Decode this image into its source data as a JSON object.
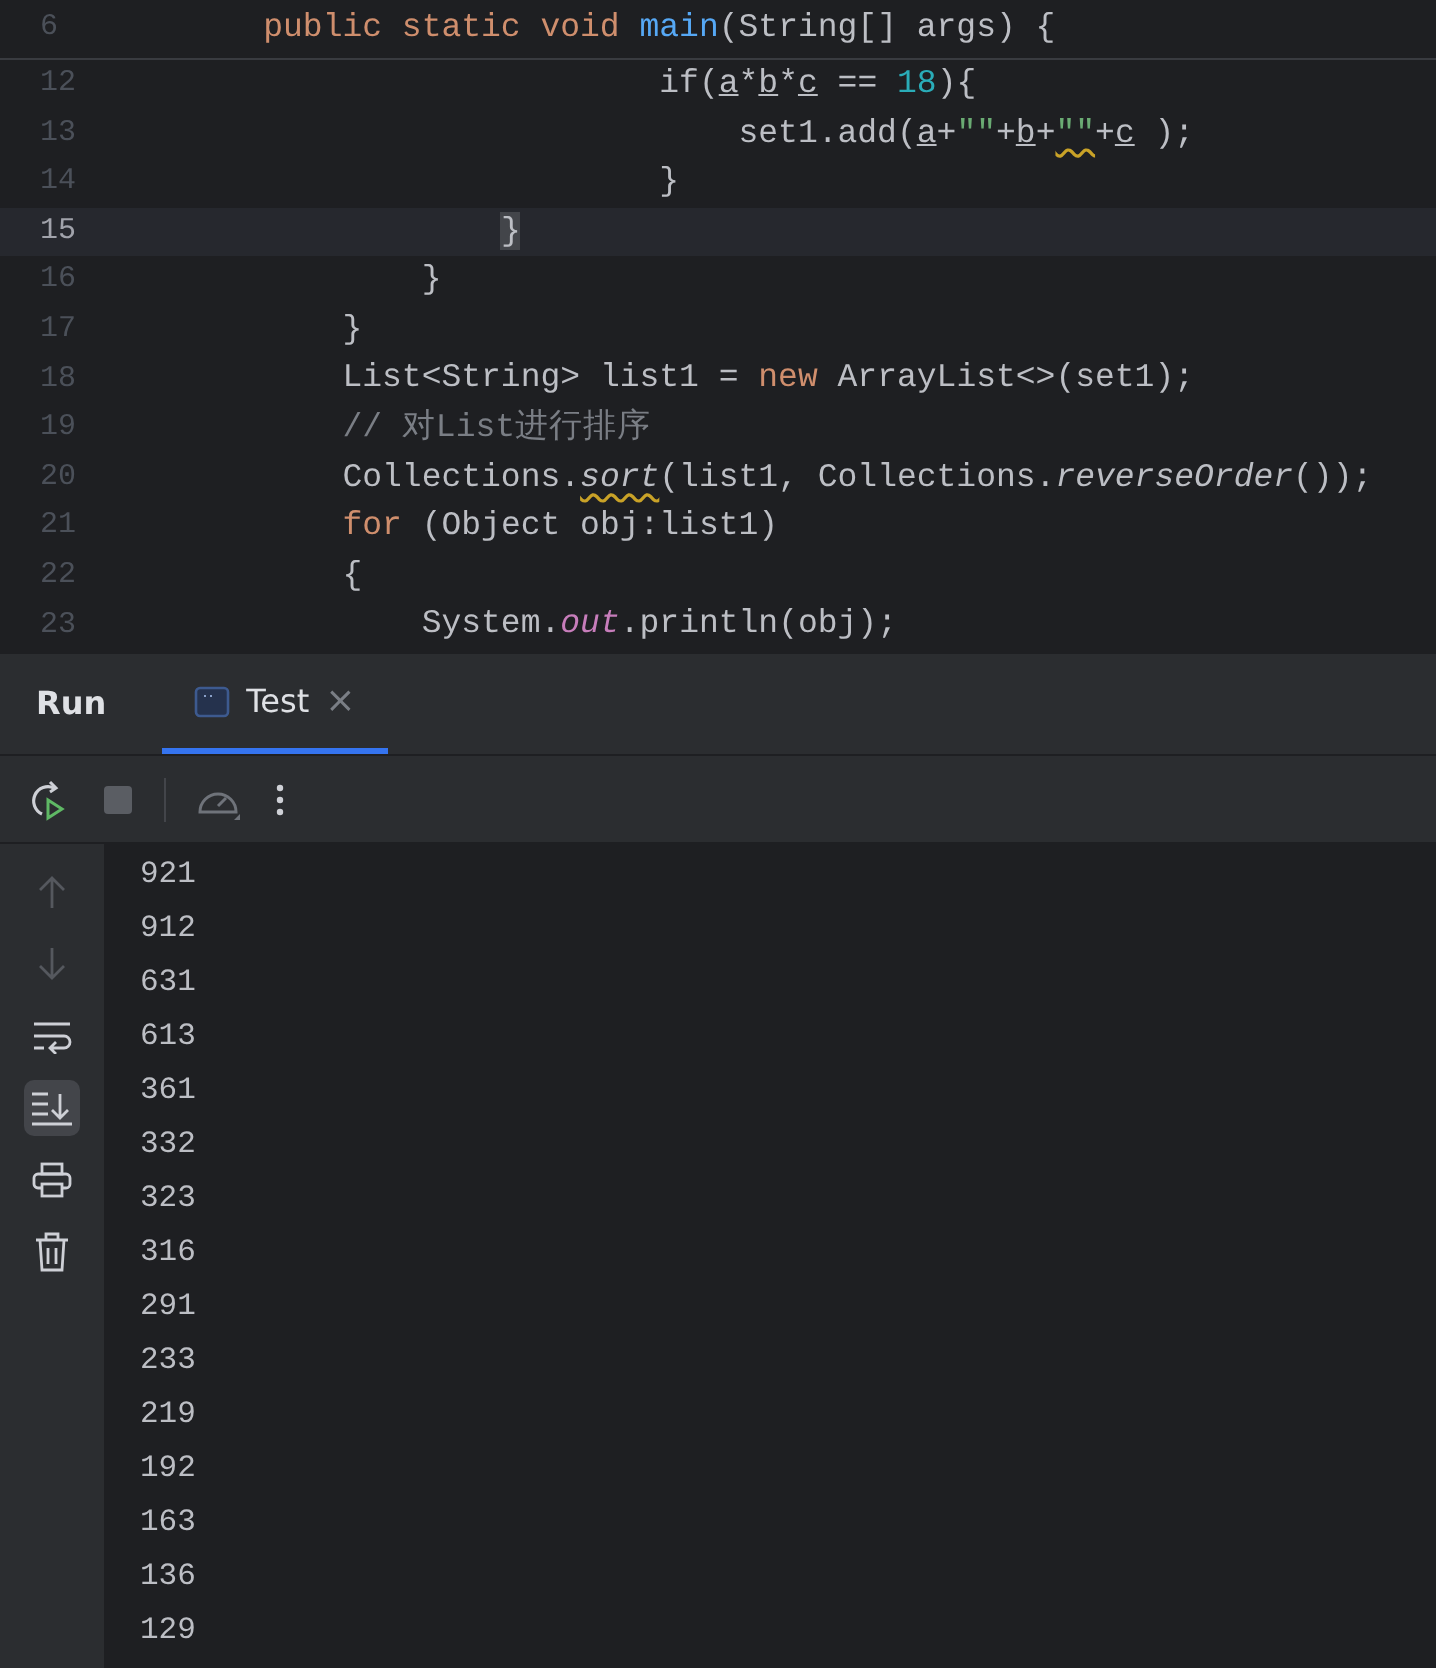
{
  "editor": {
    "sticky_line": {
      "number": "6",
      "tokens": [
        {
          "t": "    public static void ",
          "kind": "kw"
        },
        {
          "t": "main",
          "kind": "fn"
        },
        {
          "t": "(String[] args) {",
          "kind": "plain"
        }
      ]
    },
    "lines": [
      {
        "number": "12",
        "current": false,
        "tokens": [
          {
            "t": "                        if(",
            "kind": "plain"
          },
          {
            "t": "a",
            "kind": "var"
          },
          {
            "t": "*",
            "kind": "plain"
          },
          {
            "t": "b",
            "kind": "var"
          },
          {
            "t": "*",
            "kind": "plain"
          },
          {
            "t": "c",
            "kind": "var"
          },
          {
            "t": " == ",
            "kind": "plain"
          },
          {
            "t": "18",
            "kind": "num"
          },
          {
            "t": "){",
            "kind": "plain"
          }
        ]
      },
      {
        "number": "13",
        "current": false,
        "tokens": [
          {
            "t": "                            set1.add(",
            "kind": "plain"
          },
          {
            "t": "a",
            "kind": "var"
          },
          {
            "t": "+",
            "kind": "plain"
          },
          {
            "t": "\"\"",
            "kind": "str"
          },
          {
            "t": "+",
            "kind": "plain"
          },
          {
            "t": "b",
            "kind": "var"
          },
          {
            "t": "+",
            "kind": "plain"
          },
          {
            "t": "\"\"",
            "kind": "str",
            "warning": true
          },
          {
            "t": "+",
            "kind": "plain"
          },
          {
            "t": "c",
            "kind": "var"
          },
          {
            "t": " );",
            "kind": "plain"
          }
        ]
      },
      {
        "number": "14",
        "current": false,
        "tokens": [
          {
            "t": "                        }",
            "kind": "plain"
          }
        ]
      },
      {
        "number": "15",
        "current": true,
        "tokens": [
          {
            "t": "                }",
            "kind": "match"
          }
        ]
      },
      {
        "number": "16",
        "current": false,
        "tokens": [
          {
            "t": "            }",
            "kind": "plain"
          }
        ]
      },
      {
        "number": "17",
        "current": false,
        "tokens": [
          {
            "t": "        }",
            "kind": "plain"
          }
        ]
      },
      {
        "number": "18",
        "current": false,
        "tokens": [
          {
            "t": "        List<String> list1 = ",
            "kind": "plain"
          },
          {
            "t": "new",
            "kind": "kw"
          },
          {
            "t": " ArrayList<>(set1);",
            "kind": "plain"
          }
        ]
      },
      {
        "number": "19",
        "current": false,
        "tokens": [
          {
            "t": "        // 对List进行排序",
            "kind": "comment"
          }
        ]
      },
      {
        "number": "20",
        "current": false,
        "tokens": [
          {
            "t": "        Collections.",
            "kind": "plain"
          },
          {
            "t": "sort",
            "kind": "static",
            "warning": true
          },
          {
            "t": "(list1, Collections.",
            "kind": "plain"
          },
          {
            "t": "reverseOrder",
            "kind": "static"
          },
          {
            "t": "());",
            "kind": "plain"
          }
        ]
      },
      {
        "number": "21",
        "current": false,
        "tokens": [
          {
            "t": "        for",
            "kind": "kw"
          },
          {
            "t": " (Object obj:list1)",
            "kind": "plain"
          }
        ]
      },
      {
        "number": "22",
        "current": false,
        "tokens": [
          {
            "t": "        {",
            "kind": "plain"
          }
        ]
      },
      {
        "number": "23",
        "current": false,
        "tokens": [
          {
            "t": "            System.",
            "kind": "plain"
          },
          {
            "t": "out",
            "kind": "field"
          },
          {
            "t": ".println(obj);",
            "kind": "plain"
          }
        ]
      }
    ]
  },
  "run_panel": {
    "title": "Run",
    "tabs": [
      {
        "label": "Test",
        "selected": true,
        "closable": true,
        "close": "×"
      }
    ],
    "toolbar": [
      {
        "kind": "rerun",
        "disabled": false
      },
      {
        "kind": "stop",
        "disabled": true
      },
      {
        "kind": "separator"
      },
      {
        "kind": "profiler",
        "disabled": false
      },
      {
        "kind": "more",
        "disabled": false
      }
    ],
    "side_tools": [
      {
        "kind": "up",
        "disabled": true,
        "on": false
      },
      {
        "kind": "down",
        "disabled": true,
        "on": false
      },
      {
        "kind": "wrap",
        "disabled": false,
        "on": false
      },
      {
        "kind": "scroll-end",
        "disabled": false,
        "on": true
      },
      {
        "kind": "print",
        "disabled": false,
        "on": false
      },
      {
        "kind": "trash",
        "disabled": false,
        "on": false
      }
    ],
    "output": [
      "921",
      "912",
      "631",
      "613",
      "361",
      "332",
      "323",
      "316",
      "291",
      "233",
      "219",
      "192",
      "163",
      "136",
      "129"
    ]
  }
}
